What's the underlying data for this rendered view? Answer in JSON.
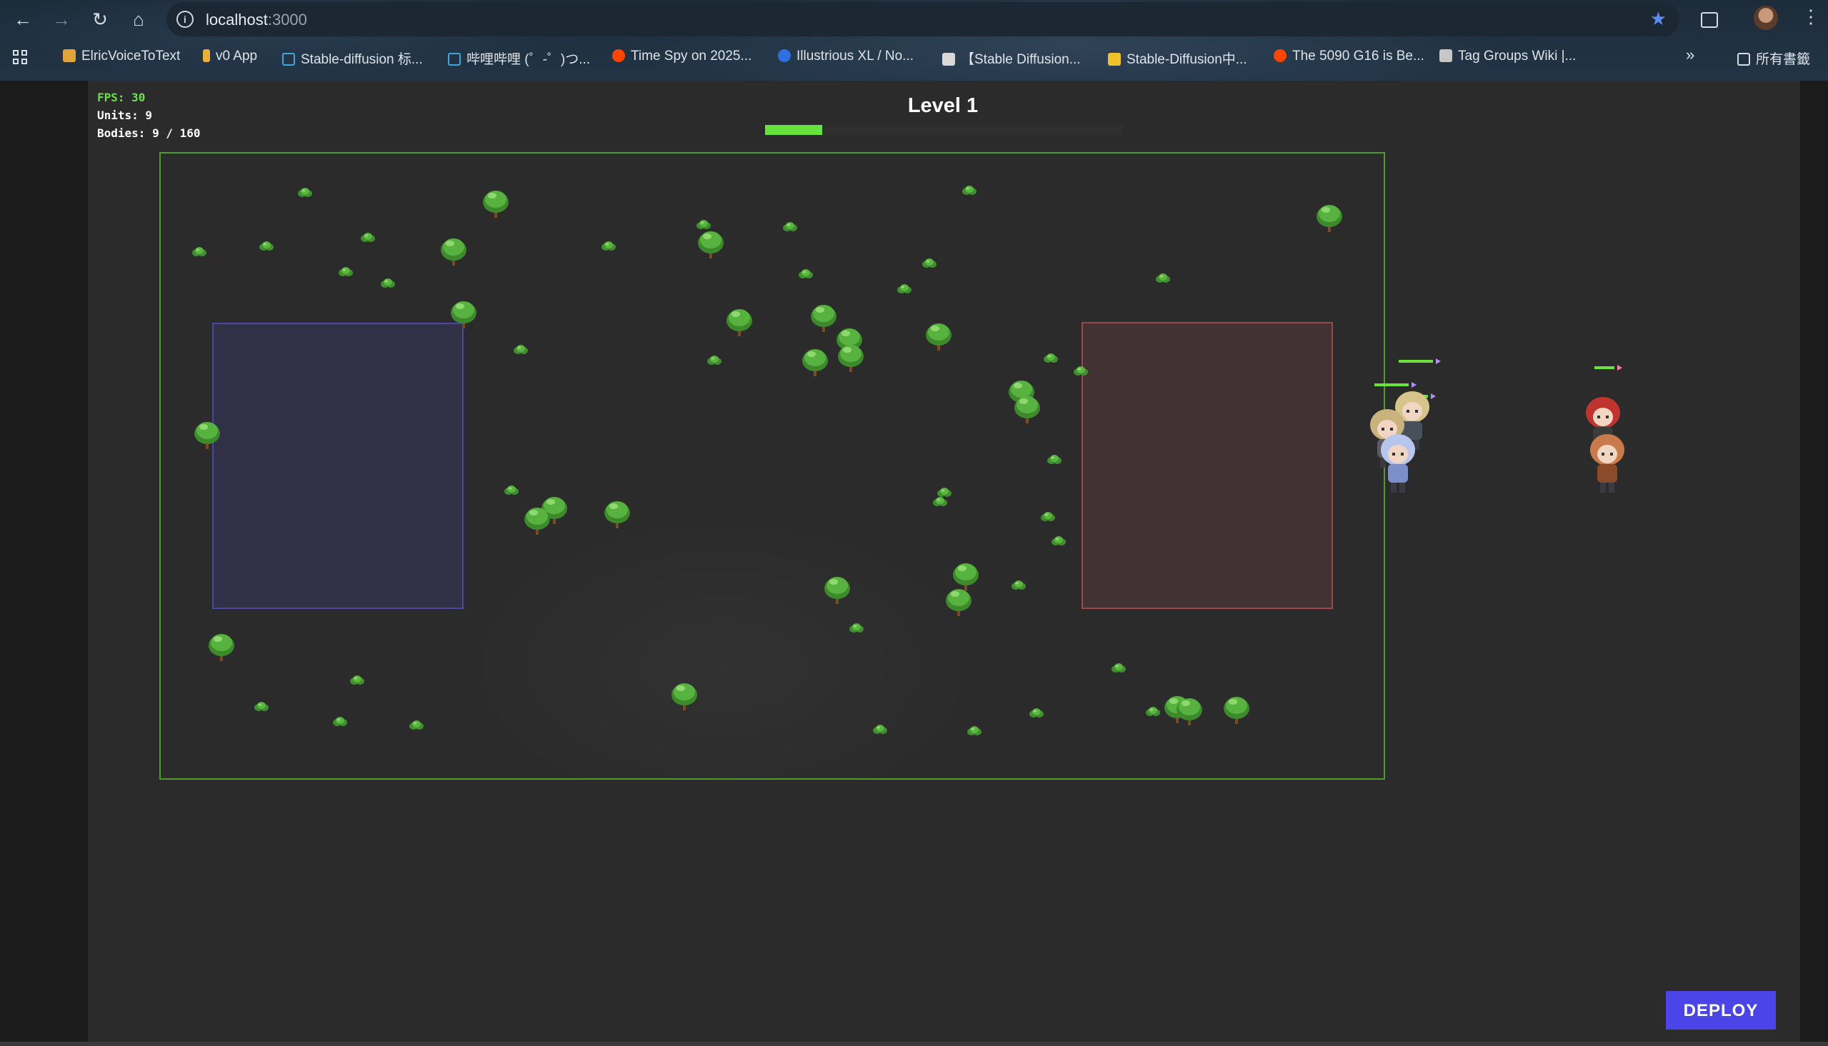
{
  "browser": {
    "url_host": "localhost",
    "url_port": ":3000",
    "bookmarks": [
      {
        "label": "ElricVoiceToText",
        "icon": "layers-icon",
        "color": "#e0a53a"
      },
      {
        "label": "v0 App",
        "icon": "bolt-icon",
        "color": "#e8b23a"
      },
      {
        "label": "Stable-diffusion 标...",
        "icon": "bilibili-icon",
        "color": "#41a6d9"
      },
      {
        "label": "哔哩哔哩 (゜-゜)つ...",
        "icon": "bilibili-icon",
        "color": "#41a6d9"
      },
      {
        "label": "Time Spy on 2025...",
        "icon": "reddit-icon",
        "color": "#ff4500"
      },
      {
        "label": "Illustrious XL / No...",
        "icon": "civitai-icon",
        "color": "#2f6fe0"
      },
      {
        "label": "【Stable Diffusion...",
        "icon": "portrait-icon",
        "color": "#d9d9d9"
      },
      {
        "label": "Stable-Diffusion中...",
        "icon": "emoji-icon",
        "color": "#f2c12e"
      },
      {
        "label": "The 5090 G16 is Be...",
        "icon": "reddit-icon",
        "color": "#ff4500"
      },
      {
        "label": "Tag Groups Wiki |...",
        "icon": "document-icon",
        "color": "#c7c7c7"
      }
    ],
    "more": "»",
    "all_bookmarks": "所有書籤"
  },
  "hud": {
    "fps": "FPS: 30",
    "units": "Units: 9",
    "bodies": "Bodies: 9 / 160",
    "level": "Level 1",
    "level_progress": 0.16
  },
  "deploy_label": "DEPLOY",
  "colors": {
    "accent": "#4b44e6",
    "health": "#6be23e",
    "player_zone": "#4a47a8",
    "enemy_zone": "#9b4848",
    "map_border": "#4f9a2a"
  }
}
